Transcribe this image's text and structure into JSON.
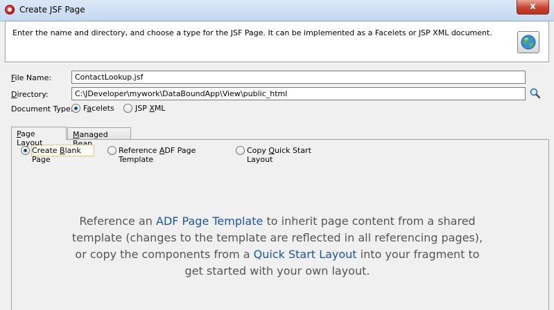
{
  "window": {
    "title": "Create JSF Page",
    "close_glyph": "x"
  },
  "header": {
    "description": "Enter the name and directory, and choose a type for the JSF Page. It can be implemented as a Facelets or JSP XML document.",
    "icon": "globe-help-icon"
  },
  "form": {
    "file_name": {
      "label_ul": "F",
      "label_rest": "ile Name:",
      "value": "ContactLookup.jsf"
    },
    "directory": {
      "label_ul": "D",
      "label_rest": "irectory:",
      "value": "C:\\JDeveloper\\mywork\\DataBoundApp\\View\\public_html",
      "browse_icon": "magnifier-icon"
    },
    "document_type": {
      "label": "Document Type:",
      "options": [
        {
          "pre": "F",
          "ul": "a",
          "post": "celets",
          "selected": true
        },
        {
          "pre": "JSP ",
          "ul": "X",
          "post": "ML",
          "selected": false
        }
      ]
    }
  },
  "tabs": [
    {
      "pre": "",
      "ul": "P",
      "post": "age Layout",
      "active": true
    },
    {
      "pre": "",
      "ul": "M",
      "post": "anaged Bean",
      "active": false
    }
  ],
  "layout_options": [
    {
      "pre": "Create ",
      "ul": "B",
      "post": "lank Page",
      "selected": true
    },
    {
      "pre": "Reference ",
      "ul": "A",
      "post": "DF Page Template",
      "selected": false
    },
    {
      "pre": "Copy ",
      "ul": "Q",
      "post": "uick Start Layout",
      "selected": false
    }
  ],
  "info": {
    "part1": "Reference an ",
    "link1": "ADF Page Template",
    "part2": " to inherit page content from a shared template (changes to the template are reflected in all referencing pages), or copy the components from a ",
    "link2": "Quick Start Layout",
    "part3": " into your fragment to get started with your own layout."
  },
  "colors": {
    "link": "#1b55a6",
    "selected_radio": "#1a4e8d",
    "focus": "#d19b24"
  }
}
